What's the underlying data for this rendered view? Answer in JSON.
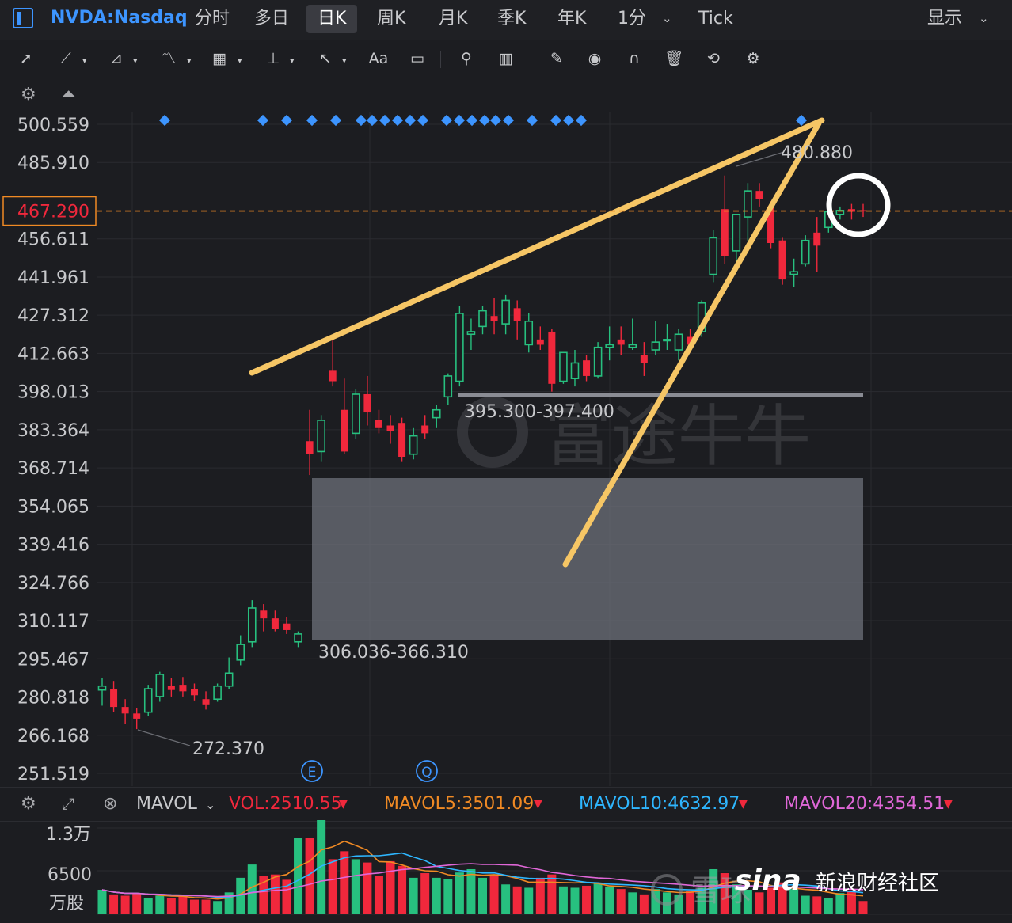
{
  "header": {
    "symbol": "NVDA:Nasdaq",
    "tabs": [
      "分时",
      "多日",
      "日K",
      "周K",
      "月K",
      "季K",
      "年K",
      "1分",
      "Tick"
    ],
    "active_tab": "日K",
    "display_label": "显示"
  },
  "toolbar": {
    "text_tool_label": "Aa"
  },
  "colors": {
    "background": "#1c1d21",
    "up": "#27c07f",
    "down": "#f0283c",
    "accent": "#3d95ff",
    "trendline": "#f6c665",
    "price_line": "#f08a24",
    "mavol5": "#f08a24",
    "mavol10": "#2eb6ff",
    "mavol20": "#e067d8"
  },
  "price_axis": {
    "ticks": [
      "500.559",
      "485.910",
      "456.611",
      "441.961",
      "427.312",
      "412.663",
      "398.013",
      "383.364",
      "368.714",
      "354.065",
      "339.416",
      "324.766",
      "310.117",
      "295.467",
      "280.818",
      "266.168",
      "251.519"
    ],
    "current_price": "467.290"
  },
  "annotations": {
    "high_label": "480.880",
    "low_label": "272.370",
    "zone_upper_label": "395.300-397.400",
    "zone_lower_label": "306.036-366.310",
    "earnings_marker": "E",
    "quarter_marker": "Q"
  },
  "watermarks": {
    "futu": "富途牛牛",
    "xueqiu": "雪球",
    "sina_logo": "sina",
    "sina_text": "新浪财经社区"
  },
  "volume": {
    "indicator": "MAVOL",
    "vol": "VOL:2510.55",
    "mavol5": "MAVOL5:3501.09",
    "mavol10": "MAVOL10:4632.97",
    "mavol20": "MAVOL20:4354.51",
    "axis_ticks": [
      "1.3万",
      "6500",
      "万股"
    ]
  },
  "chart_data": {
    "type": "candlestick",
    "ylim": [
      251.519,
      500.559
    ],
    "current_price": 467.29,
    "candles": [
      {
        "o": 283.5,
        "h": 288.0,
        "l": 277.5,
        "c": 285.0
      },
      {
        "o": 284.0,
        "h": 287.0,
        "l": 275.0,
        "c": 277.0
      },
      {
        "o": 277.0,
        "h": 280.0,
        "l": 270.5,
        "c": 274.5
      },
      {
        "o": 274.5,
        "h": 276.5,
        "l": 268.5,
        "c": 272.5
      },
      {
        "o": 275.0,
        "h": 285.5,
        "l": 273.5,
        "c": 284.0
      },
      {
        "o": 281.0,
        "h": 290.5,
        "l": 279.0,
        "c": 289.5
      },
      {
        "o": 285.0,
        "h": 288.0,
        "l": 281.0,
        "c": 283.5
      },
      {
        "o": 285.5,
        "h": 288.5,
        "l": 281.0,
        "c": 283.0
      },
      {
        "o": 284.0,
        "h": 286.0,
        "l": 279.5,
        "c": 281.5
      },
      {
        "o": 280.0,
        "h": 283.0,
        "l": 276.0,
        "c": 278.0
      },
      {
        "o": 280.0,
        "h": 286.0,
        "l": 279.0,
        "c": 285.0
      },
      {
        "o": 285.0,
        "h": 296.0,
        "l": 284.0,
        "c": 290.0
      },
      {
        "o": 295.0,
        "h": 304.5,
        "l": 293.0,
        "c": 301.0
      },
      {
        "o": 302.0,
        "h": 318.0,
        "l": 300.0,
        "c": 315.0
      },
      {
        "o": 314.0,
        "h": 316.5,
        "l": 306.0,
        "c": 311.0
      },
      {
        "o": 311.0,
        "h": 314.0,
        "l": 306.0,
        "c": 307.0
      },
      {
        "o": 309.0,
        "h": 311.5,
        "l": 305.0,
        "c": 306.5
      },
      {
        "o": 302.0,
        "h": 306.0,
        "l": 300.0,
        "c": 305.0
      },
      {
        "o": 379.0,
        "h": 391.0,
        "l": 366.0,
        "c": 374.0
      },
      {
        "o": 375.0,
        "h": 389.0,
        "l": 371.0,
        "c": 387.0
      },
      {
        "o": 406.0,
        "h": 418.0,
        "l": 400.0,
        "c": 402.0
      },
      {
        "o": 391.0,
        "h": 403.0,
        "l": 374.0,
        "c": 375.0
      },
      {
        "o": 382.0,
        "h": 399.0,
        "l": 380.0,
        "c": 397.0
      },
      {
        "o": 397.0,
        "h": 404.0,
        "l": 385.0,
        "c": 390.0
      },
      {
        "o": 387.0,
        "h": 391.0,
        "l": 382.0,
        "c": 384.0
      },
      {
        "o": 385.0,
        "h": 389.0,
        "l": 378.0,
        "c": 383.0
      },
      {
        "o": 386.0,
        "h": 388.0,
        "l": 371.0,
        "c": 373.0
      },
      {
        "o": 374.0,
        "h": 384.0,
        "l": 372.0,
        "c": 381.0
      },
      {
        "o": 385.0,
        "h": 389.0,
        "l": 380.0,
        "c": 382.0
      },
      {
        "o": 388.0,
        "h": 393.0,
        "l": 384.0,
        "c": 391.0
      },
      {
        "o": 396.0,
        "h": 405.0,
        "l": 393.0,
        "c": 404.0
      },
      {
        "o": 402.0,
        "h": 431.0,
        "l": 400.0,
        "c": 428.0
      },
      {
        "o": 420.0,
        "h": 426.0,
        "l": 414.0,
        "c": 421.0
      },
      {
        "o": 423.0,
        "h": 431.0,
        "l": 420.0,
        "c": 429.0
      },
      {
        "o": 427.0,
        "h": 434.0,
        "l": 420.0,
        "c": 425.0
      },
      {
        "o": 424.0,
        "h": 435.0,
        "l": 420.0,
        "c": 433.0
      },
      {
        "o": 430.0,
        "h": 433.0,
        "l": 418.0,
        "c": 425.0
      },
      {
        "o": 416.0,
        "h": 428.0,
        "l": 413.0,
        "c": 425.0
      },
      {
        "o": 418.0,
        "h": 423.0,
        "l": 414.0,
        "c": 416.0
      },
      {
        "o": 421.0,
        "h": 422.0,
        "l": 398.0,
        "c": 401.0
      },
      {
        "o": 402.0,
        "h": 413.0,
        "l": 401.0,
        "c": 413.0
      },
      {
        "o": 403.0,
        "h": 414.0,
        "l": 400.0,
        "c": 409.0
      },
      {
        "o": 410.0,
        "h": 412.0,
        "l": 402.0,
        "c": 404.0
      },
      {
        "o": 404.0,
        "h": 417.0,
        "l": 403.0,
        "c": 415.0
      },
      {
        "o": 415.0,
        "h": 423.0,
        "l": 410.0,
        "c": 416.0
      },
      {
        "o": 418.0,
        "h": 423.0,
        "l": 412.0,
        "c": 416.0
      },
      {
        "o": 415.0,
        "h": 426.0,
        "l": 414.0,
        "c": 416.0
      },
      {
        "o": 412.0,
        "h": 417.0,
        "l": 404.0,
        "c": 409.0
      },
      {
        "o": 414.0,
        "h": 425.0,
        "l": 412.0,
        "c": 417.0
      },
      {
        "o": 418.0,
        "h": 424.0,
        "l": 414.0,
        "c": 418.0
      },
      {
        "o": 414.0,
        "h": 422.0,
        "l": 410.0,
        "c": 420.0
      },
      {
        "o": 419.0,
        "h": 422.0,
        "l": 413.0,
        "c": 416.0
      },
      {
        "o": 421.0,
        "h": 433.0,
        "l": 419.0,
        "c": 432.0
      },
      {
        "o": 443.0,
        "h": 460.0,
        "l": 440.0,
        "c": 457.0
      },
      {
        "o": 468.0,
        "h": 480.9,
        "l": 447.0,
        "c": 450.0
      },
      {
        "o": 452.0,
        "h": 466.0,
        "l": 446.0,
        "c": 466.0
      },
      {
        "o": 465.0,
        "h": 478.0,
        "l": 456.0,
        "c": 475.0
      },
      {
        "o": 475.0,
        "h": 478.0,
        "l": 469.0,
        "c": 472.0
      },
      {
        "o": 469.0,
        "h": 471.0,
        "l": 453.0,
        "c": 455.0
      },
      {
        "o": 456.0,
        "h": 457.0,
        "l": 439.0,
        "c": 441.0
      },
      {
        "o": 443.0,
        "h": 449.0,
        "l": 438.0,
        "c": 444.0
      },
      {
        "o": 447.0,
        "h": 458.0,
        "l": 446.0,
        "c": 456.0
      },
      {
        "o": 459.0,
        "h": 465.0,
        "l": 444.0,
        "c": 454.0
      },
      {
        "o": 461.0,
        "h": 468.0,
        "l": 459.0,
        "c": 467.0
      },
      {
        "o": 466.0,
        "h": 469.0,
        "l": 464.0,
        "c": 467.5
      },
      {
        "o": 468.0,
        "h": 470.0,
        "l": 464.0,
        "c": 467.0
      },
      {
        "o": 467.6,
        "h": 470.0,
        "l": 465.0,
        "c": 467.29
      }
    ],
    "volumes": [
      0.37,
      0.3,
      0.28,
      0.32,
      0.25,
      0.28,
      0.24,
      0.27,
      0.22,
      0.22,
      0.2,
      0.33,
      0.55,
      0.75,
      0.58,
      0.6,
      0.52,
      1.15,
      1.15,
      1.43,
      0.83,
      0.95,
      0.83,
      0.78,
      0.58,
      0.8,
      0.73,
      0.55,
      0.62,
      0.55,
      0.53,
      0.63,
      0.68,
      0.55,
      0.6,
      0.45,
      0.42,
      0.4,
      0.55,
      0.6,
      0.42,
      0.4,
      0.43,
      0.47,
      0.42,
      0.38,
      0.33,
      0.3,
      0.38,
      0.33,
      0.3,
      0.35,
      0.4,
      0.68,
      0.62,
      0.45,
      0.37,
      0.33,
      0.4,
      0.48,
      0.38,
      0.28,
      0.27,
      0.25,
      0.32,
      0.35,
      0.2
    ],
    "volume_axis_max": 1.3,
    "volume_axis_unit": "万股"
  }
}
